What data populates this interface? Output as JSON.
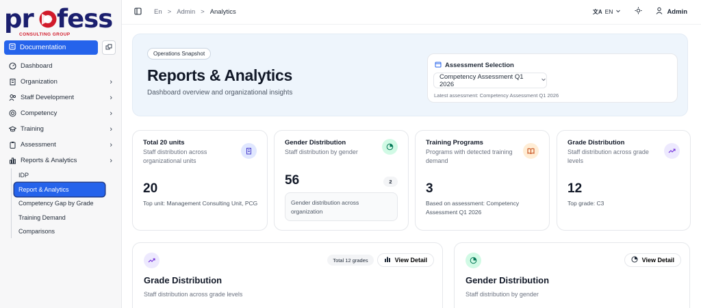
{
  "brand": {
    "word": "profess",
    "sub": "CONSULTING GROUP",
    "colors": {
      "navy": "#1b1f6e",
      "red": "#d11a2a"
    }
  },
  "sidebar": {
    "doc_label": "Documentation",
    "items": [
      {
        "label": "Dashboard",
        "icon": "dashboard-icon",
        "chevron": false
      },
      {
        "label": "Organization",
        "icon": "building-icon",
        "chevron": true
      },
      {
        "label": "Staff Development",
        "icon": "users-icon",
        "chevron": true
      },
      {
        "label": "Competency",
        "icon": "target-icon",
        "chevron": true
      },
      {
        "label": "Training",
        "icon": "graduation-cap-icon",
        "chevron": true
      },
      {
        "label": "Assessment",
        "icon": "clipboard-icon",
        "chevron": true
      },
      {
        "label": "Reports & Analytics",
        "icon": "bar-chart-icon",
        "chevron": true
      }
    ],
    "sub_items": [
      "IDP",
      "Report & Analytics",
      "Competency Gap by Grade",
      "Training Demand",
      "Comparisons"
    ],
    "chevron": "›"
  },
  "topbar": {
    "breadcrumb": [
      "En",
      "Admin",
      "Analytics"
    ],
    "separator": ">",
    "lang": "EN",
    "user": "Admin"
  },
  "hero": {
    "pill": "Operations Snapshot",
    "title": "Reports & Analytics",
    "subtitle": "Dashboard overview and organizational insights",
    "assessment": {
      "heading": "Assessment Selection",
      "selected": "Competency Assessment Q1 2026",
      "note": "Latest assessment: Competency Assessment Q1 2026"
    }
  },
  "cards": [
    {
      "title": "Total 20 units",
      "subtitle": "Staff distribution across organizational units",
      "value": "20",
      "footer": "Top unit: Management Consulting Unit, PCG"
    },
    {
      "title": "Gender Distribution",
      "subtitle": "Staff distribution by gender",
      "value": "56",
      "badge": "2",
      "box": "Gender distribution across organization"
    },
    {
      "title": "Training Programs",
      "subtitle": "Programs with detected training demand",
      "value": "3",
      "footer": "Based on assessment: Competency Assessment Q1 2026"
    },
    {
      "title": "Grade Distribution",
      "subtitle": "Staff distribution across grade levels",
      "value": "12",
      "footer": "Top grade: C3"
    }
  ],
  "panels": [
    {
      "title": "Grade Distribution",
      "subtitle": "Staff distribution across grade levels",
      "total": "Total 12 grades",
      "button": "View Detail"
    },
    {
      "title": "Gender Distribution",
      "subtitle": "Staff distribution by gender",
      "button": "View Detail"
    }
  ],
  "colors": {
    "accent": "#2563eb",
    "hero_bg": "#eef5fc",
    "icon_blue": "#e0e7ff",
    "icon_green": "#d1fae5",
    "icon_orange": "#ffedd5",
    "icon_purple": "#ede9fe"
  }
}
